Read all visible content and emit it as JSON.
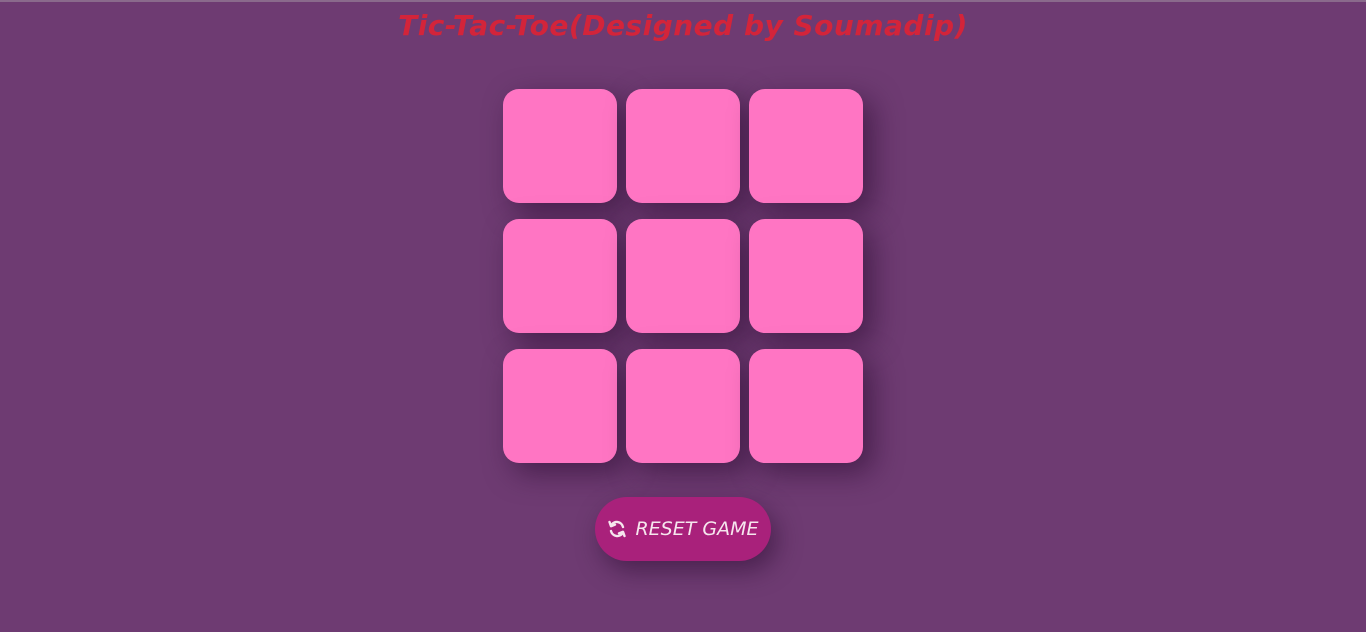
{
  "title": "Tic-Tac-Toe(Designed by Soumadip)",
  "board": {
    "cells": [
      "",
      "",
      "",
      "",
      "",
      "",
      "",
      "",
      ""
    ]
  },
  "reset_button": {
    "icon": "refresh-icon",
    "label": "RESET GAME"
  },
  "colors": {
    "background": "#6e3b72",
    "title": "#d3243a",
    "cell": "#ff75c3",
    "button": "#a9217b",
    "button_text": "#f6e6ee"
  }
}
